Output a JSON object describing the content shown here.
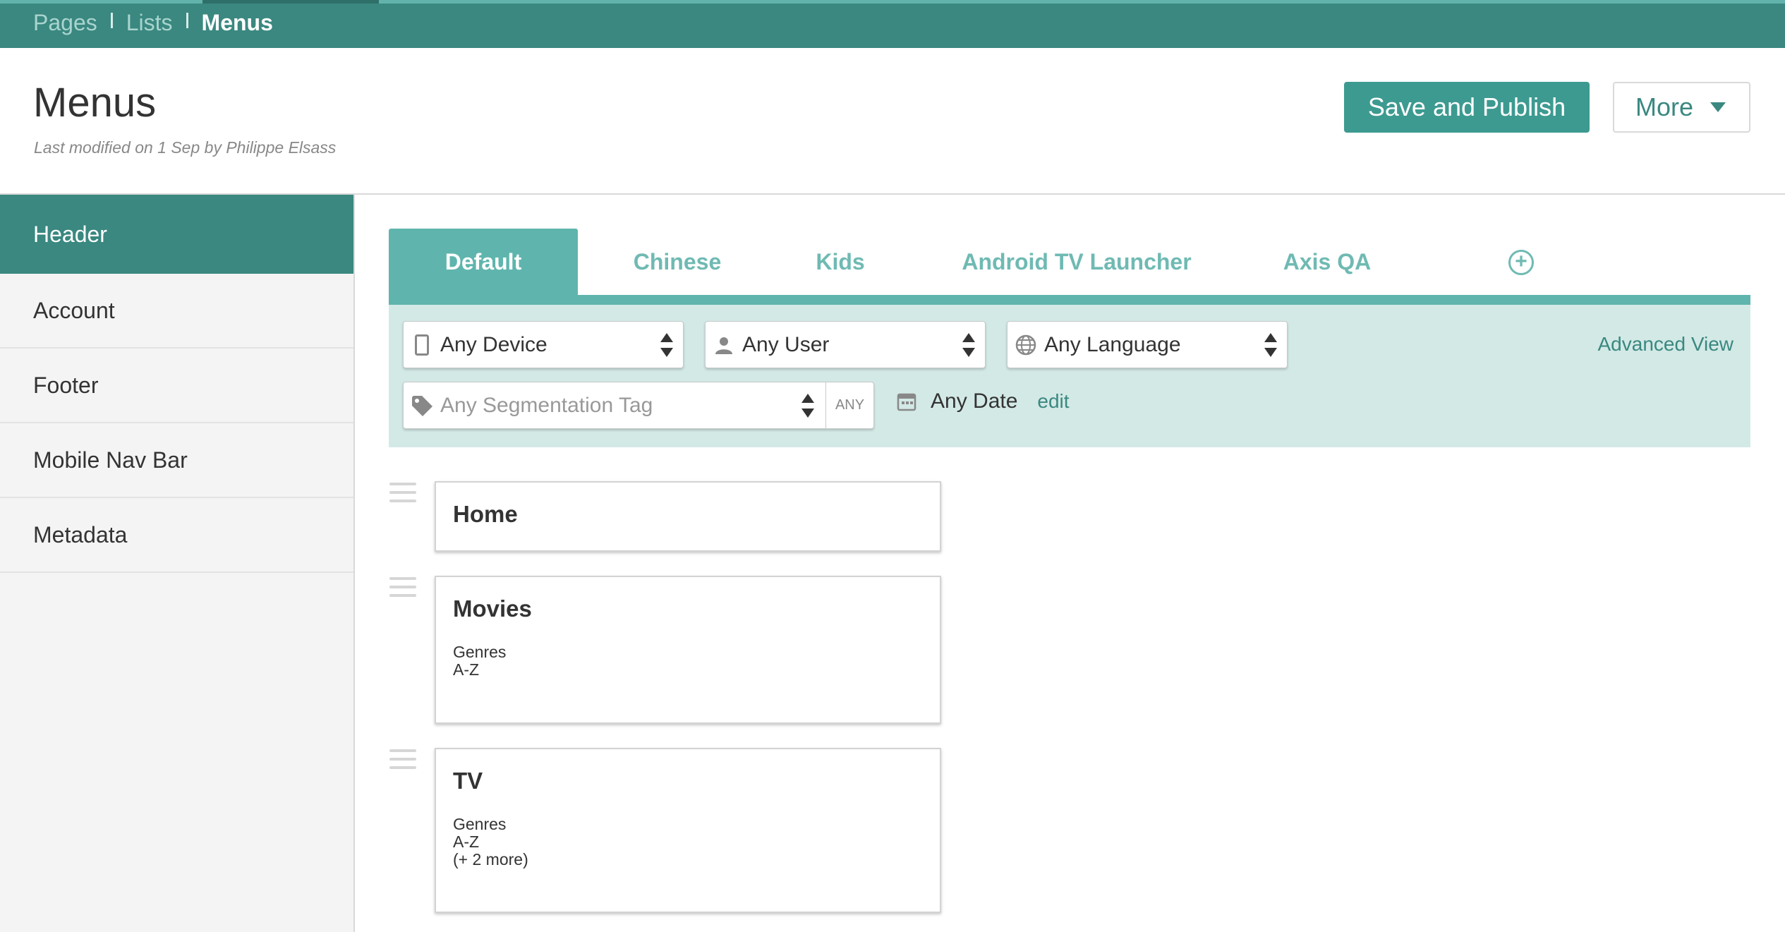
{
  "breadcrumb": {
    "items": [
      "Pages",
      "Lists",
      "Menus"
    ]
  },
  "header": {
    "title": "Menus",
    "meta": "Last modified on 1 Sep by Philippe Elsass",
    "publish_label": "Save and Publish",
    "more_label": "More"
  },
  "sidebar": {
    "items": [
      {
        "label": "Header",
        "active": true
      },
      {
        "label": "Account"
      },
      {
        "label": "Footer"
      },
      {
        "label": "Mobile Nav Bar"
      },
      {
        "label": "Metadata"
      }
    ]
  },
  "tabs": [
    {
      "label": "Default",
      "active": true
    },
    {
      "label": "Chinese"
    },
    {
      "label": "Kids"
    },
    {
      "label": "Android TV Launcher"
    },
    {
      "label": "Axis QA"
    }
  ],
  "filters": {
    "device": "Any Device",
    "user": "Any User",
    "language": "Any Language",
    "segment_placeholder": "Any Segmentation Tag",
    "segment_mode": "ANY",
    "date": "Any Date",
    "date_edit": "edit",
    "advanced_view": "Advanced View"
  },
  "menu_items": [
    {
      "title": "Home",
      "children": []
    },
    {
      "title": "Movies",
      "children": [
        "Genres",
        "A-Z"
      ]
    },
    {
      "title": "TV",
      "children": [
        "Genres",
        "A-Z",
        "(+ 2 more)"
      ]
    }
  ],
  "colors": {
    "accent": "#3a8880",
    "tab": "#5fb5ad",
    "panel": "#d3e9e6"
  }
}
